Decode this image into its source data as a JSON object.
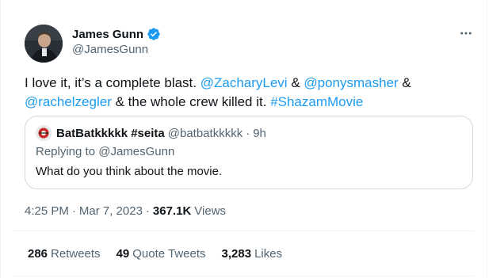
{
  "author": {
    "name": "James Gunn",
    "handle": "@JamesGunn",
    "verified": true
  },
  "tweet": {
    "text_parts": [
      {
        "text": "I love it, it’s a complete blast. ",
        "link": false
      },
      {
        "text": "@ZacharyLevi",
        "link": true
      },
      {
        "text": " & ",
        "link": false
      },
      {
        "text": "@ponysmasher",
        "link": true
      },
      {
        "text": " & ",
        "link": false
      },
      {
        "text": "@rachelzegler",
        "link": true
      },
      {
        "text": " & the whole crew killed it. ",
        "link": false
      },
      {
        "text": "#ShazamMovie",
        "link": true
      }
    ]
  },
  "quoted": {
    "name": "BatBatkkkkk #seita",
    "handle": "@batbatkkkkk",
    "dot": "·",
    "time": "9h",
    "reply_prefix": "Replying to ",
    "reply_to": "@JamesGunn",
    "text": "What do you think about the movie."
  },
  "meta": {
    "time": "4:25 PM",
    "dot1": "·",
    "date": "Mar 7, 2023",
    "dot2": "·",
    "views_count": "367.1K",
    "views_label": "Views"
  },
  "stats": {
    "retweets_count": "286",
    "retweets_label": "Retweets",
    "quotes_count": "49",
    "quotes_label": "Quote Tweets",
    "likes_count": "3,283",
    "likes_label": "Likes"
  },
  "colors": {
    "accent": "#1d9bf0",
    "text": "#0f1419",
    "secondary": "#536471",
    "border": "#cfd9de"
  },
  "icons": {
    "verified": "verified-badge-icon",
    "more": "more-horizontal-icon"
  }
}
